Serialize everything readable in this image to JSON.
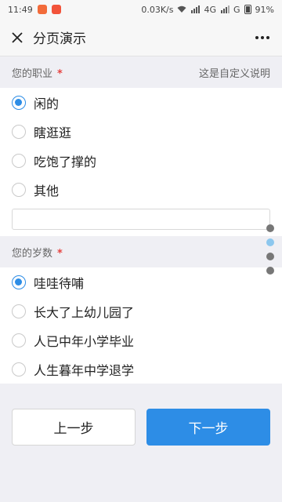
{
  "statusbar": {
    "time": "11:49",
    "speed": "0.03K/s",
    "network": "4G",
    "network2": "G",
    "battery": "91%",
    "app_icon_colors": [
      "#f26b3a",
      "#f2533a"
    ]
  },
  "navbar": {
    "title": "分页演示"
  },
  "q1": {
    "label": "您的职业",
    "required": "*",
    "description": "这是自定义说明",
    "options": [
      "闲的",
      "瞎逛逛",
      "吃饱了撑的",
      "其他"
    ],
    "selected": 0,
    "other_value": ""
  },
  "q2": {
    "label": "您的岁数",
    "required": "*",
    "options": [
      "哇哇待哺",
      "长大了上幼儿园了",
      "人已中年小学毕业",
      "人生暮年中学退学"
    ],
    "selected": 0
  },
  "pagination": {
    "pages": 4,
    "current": 1
  },
  "buttons": {
    "prev": "上一步",
    "next": "下一步"
  },
  "colors": {
    "accent": "#2d8de6",
    "required": "#e64340",
    "indicator_active": "#8cc7ee",
    "indicator": "#777777"
  }
}
